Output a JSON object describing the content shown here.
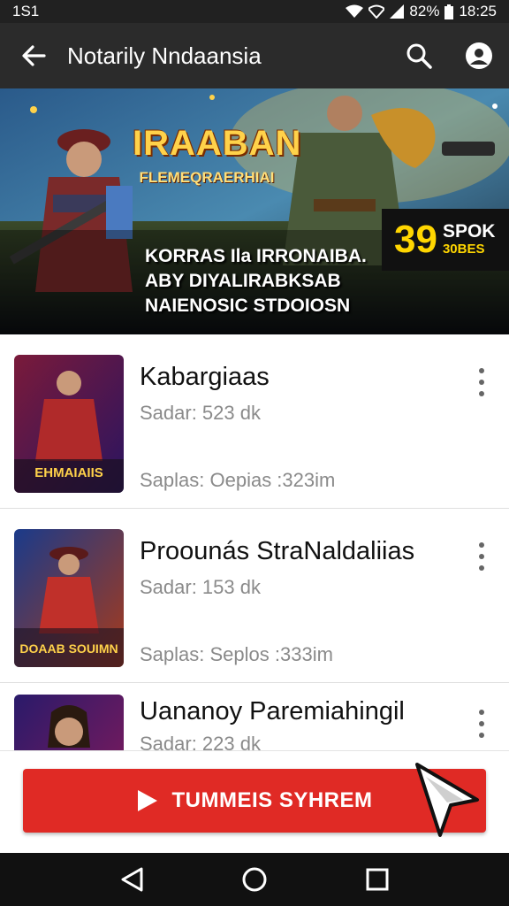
{
  "status_bar": {
    "left": "1S1",
    "battery": "82%",
    "time": "18:25"
  },
  "app_bar": {
    "title": "Notarily Nndaansia"
  },
  "banner": {
    "title": "IRAABAN",
    "subtitle": "FLEMEQRAERHIAI",
    "lines": [
      "KORRAS Ila IRRONAIBA.",
      "ABY DIYALIRABKSAB",
      "NAIENOSIC STDOIOSN"
    ],
    "promo_number": "39",
    "promo_top": "SPOK",
    "promo_bottom": "30BES"
  },
  "items": [
    {
      "title": "Kabargiaas",
      "sub": "Sadar: 523 dk",
      "meta": "Saplas: Oepias :323im",
      "thumb_caption": "EHMAIAIIS",
      "thumb_colors": [
        "#7a1a3a",
        "#2a1460"
      ]
    },
    {
      "title": "Proounás StraNaldaliias",
      "sub": "Sadar: 153 dk",
      "meta": "Saplas: Seplos :333im",
      "thumb_caption": "DOAAB SOUIMN",
      "thumb_colors": [
        "#1a3a8a",
        "#a83a1a"
      ]
    },
    {
      "title": "Uananoy Paremiahingil",
      "sub": "Sadar: 223 dk",
      "meta": "",
      "thumb_caption": "",
      "thumb_colors": [
        "#2a1a6a",
        "#8a1a5a"
      ]
    }
  ],
  "cta": {
    "label": "TUMMEIS SYHREM"
  },
  "colors": {
    "accent": "#e02a25",
    "app_bar": "#2b2b2b",
    "status_bar": "#212121",
    "nav_bar": "#111111"
  },
  "icons": [
    "back-arrow-icon",
    "search-icon",
    "profile-icon",
    "play-icon",
    "more-vert-icon",
    "cursor-icon",
    "nav-back-icon",
    "nav-home-icon",
    "nav-recents-icon"
  ]
}
